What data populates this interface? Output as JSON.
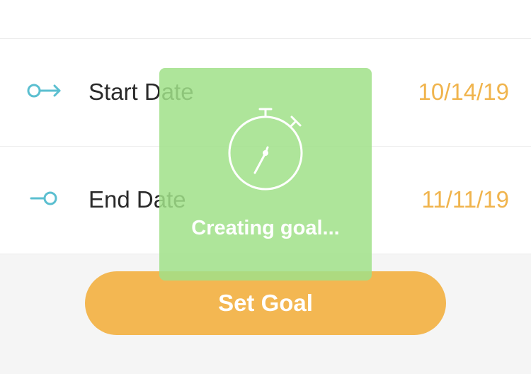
{
  "rows": [
    {
      "label": "Start Date",
      "value": "10/14/19",
      "icon": "start-arrow-icon"
    },
    {
      "label": "End Date",
      "value": "11/11/19",
      "icon": "end-marker-icon"
    }
  ],
  "action": {
    "label": "Set Goal"
  },
  "loading": {
    "text": "Creating goal...",
    "icon": "stopwatch-icon"
  },
  "colors": {
    "accent": "#f3b752",
    "date_text": "#f0b44d",
    "icon_teal": "#5bbfd0",
    "overlay": "#a0e088"
  }
}
